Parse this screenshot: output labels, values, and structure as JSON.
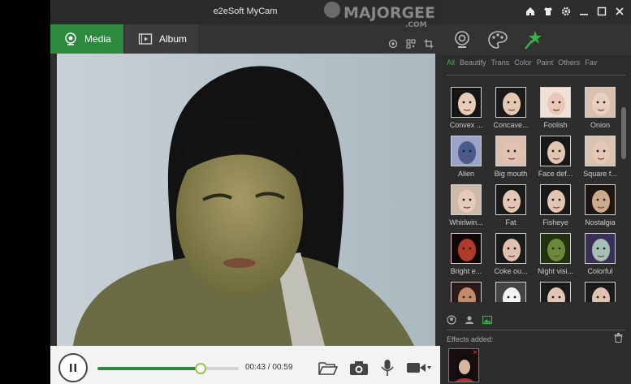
{
  "app": {
    "title": "e2eSoft MyCam"
  },
  "watermark": {
    "brand": "MAJORGEEKS",
    "domain": ".COM"
  },
  "tabs": [
    {
      "label": "Media",
      "icon": "webcam-icon",
      "active": true
    },
    {
      "label": "Album",
      "icon": "film-icon",
      "active": false
    }
  ],
  "playback": {
    "time": "00:43 / 00:59",
    "progress": 0.73
  },
  "panel": {
    "categories": [
      "All",
      "Beautify",
      "Trans",
      "Color",
      "Paint",
      "Others",
      "Fav"
    ],
    "active_category": "All",
    "effects": [
      "Convex ...",
      "Concave...",
      "Foolish",
      "Onion",
      "Alien",
      "Big mouth",
      "Face def...",
      "Square f...",
      "Whirlwin...",
      "Fat",
      "Fisheye",
      "Nostalgia",
      "Bright e...",
      "Coke ou...",
      "Night visi...",
      "Colorful",
      "",
      "",
      "",
      ""
    ],
    "effects_added_label": "Effects added:",
    "remove_symbol": "×"
  },
  "colors": {
    "accent": "#2c8a3d",
    "panel_bg": "#2d2d2d",
    "playbar_bg": "#f3f3f3"
  }
}
